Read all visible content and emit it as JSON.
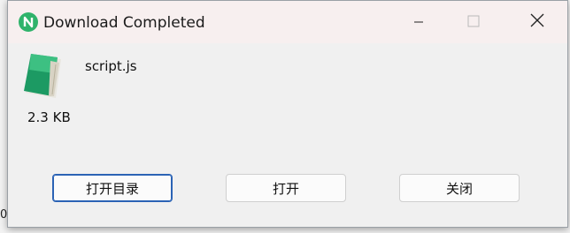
{
  "dialog": {
    "title": "Download Completed",
    "app_icon": "n-logo-icon",
    "window_controls": [
      "minimize-icon",
      "maximize-icon",
      "close-icon"
    ]
  },
  "file": {
    "name": "script.js",
    "size": "2.3 KB",
    "icon": "notepad-file-icon"
  },
  "buttons": {
    "open_folder": "打开目录",
    "open": "打开",
    "close": "关闭"
  },
  "colors": {
    "accent_green": "#2fb36b",
    "primary_border": "#2b63b5",
    "titlebar_bg": "#f7efef"
  }
}
